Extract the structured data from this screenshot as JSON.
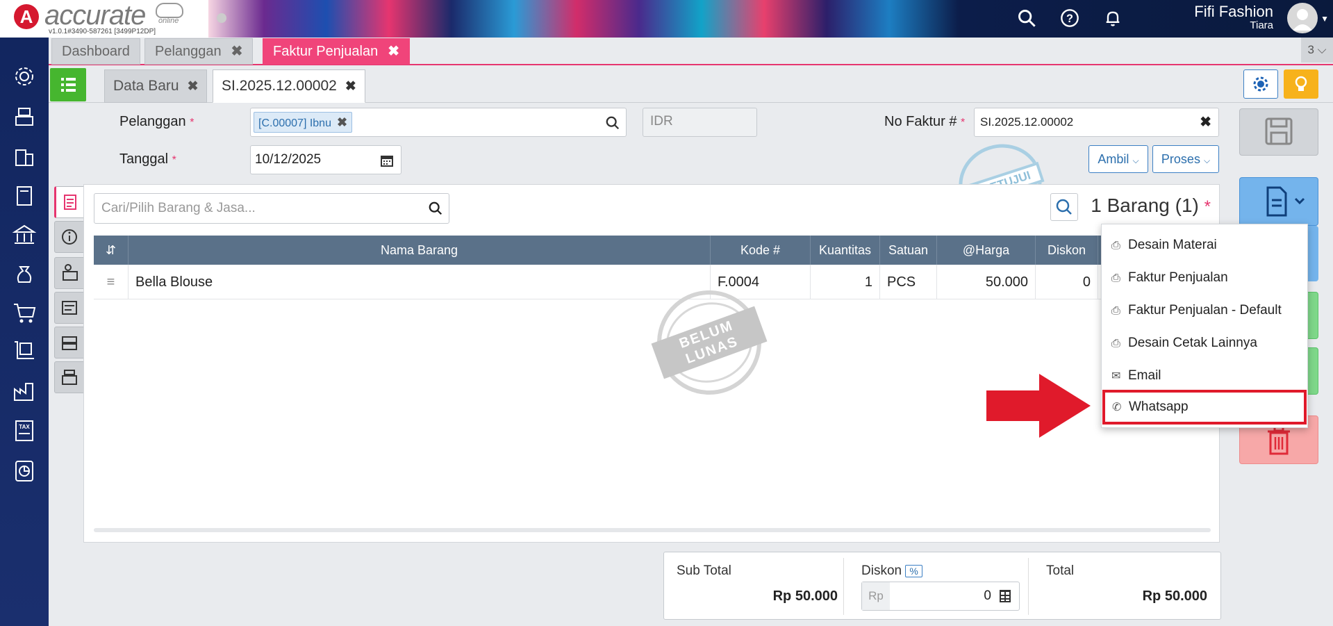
{
  "app": {
    "logo_text": "accurate",
    "logo_sub": "online",
    "version": "v1.0.1#3490-587261 [3499P12DP]",
    "user_name": "Fifi Fashion",
    "user_sub": "Tiara"
  },
  "module_tabs": [
    {
      "label": "Dashboard"
    },
    {
      "label": "Pelanggan"
    },
    {
      "label": "Faktur Penjualan"
    }
  ],
  "tab_count": "3",
  "sub_tabs": [
    {
      "label": "Data Baru"
    },
    {
      "label": "SI.2025.12.00002"
    }
  ],
  "form": {
    "pelanggan_label": "Pelanggan",
    "pelanggan_chip": "[C.00007] Ibnu",
    "currency_placeholder": "IDR",
    "no_faktur_label": "No Faktur #",
    "no_faktur_value": "SI.2025.12.00002",
    "tanggal_label": "Tanggal",
    "tanggal_value": "10/12/2025",
    "required_mark": "*",
    "ambil_label": "Ambil",
    "proses_label": "Proses"
  },
  "items": {
    "search_placeholder": "Cari/Pilih Barang & Jasa...",
    "count_title": "1 Barang (1)",
    "columns": [
      "Nama Barang",
      "Kode #",
      "Kuantitas",
      "Satuan",
      "@Harga",
      "Diskon"
    ],
    "rows": [
      {
        "nama": "Bella Blouse",
        "kode": "F.0004",
        "kuantitas": "1",
        "satuan": "PCS",
        "harga": "50.000",
        "diskon": "0"
      }
    ]
  },
  "stamps": {
    "approved": "DISETUJUI",
    "unpaid_line1": "BELUM",
    "unpaid_line2": "LUNAS"
  },
  "print_menu": [
    {
      "label": "Desain Materai",
      "icon": "printer-icon"
    },
    {
      "label": "Faktur Penjualan",
      "icon": "printer-icon"
    },
    {
      "label": "Faktur Penjualan - Default",
      "icon": "printer-icon"
    },
    {
      "label": "Desain Cetak Lainnya",
      "icon": "printer-icon"
    },
    {
      "label": "Email",
      "icon": "mail-icon"
    },
    {
      "label": "Whatsapp",
      "icon": "whatsapp-icon"
    }
  ],
  "totals": {
    "subtotal_label": "Sub Total",
    "subtotal_value": "Rp 50.000",
    "diskon_label": "Diskon",
    "diskon_badge": "%",
    "diskon_prefix": "Rp",
    "diskon_value": "0",
    "total_label": "Total",
    "total_value": "Rp 50.000"
  },
  "colors": {
    "accent": "#f0447a",
    "sidebar": "#12265f",
    "highlight": "#e01a2b"
  }
}
